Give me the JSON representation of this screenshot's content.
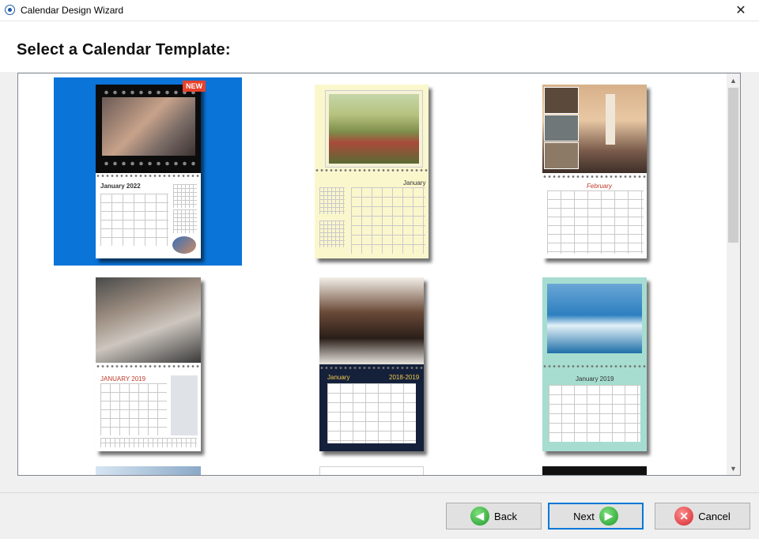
{
  "window": {
    "title": "Calendar Design Wizard",
    "close_glyph": "✕"
  },
  "page": {
    "heading": "Select a Calendar Template:"
  },
  "templates": [
    {
      "badge": "NEW",
      "caption": "January 2022"
    },
    {
      "caption": "January"
    },
    {
      "caption": "February"
    },
    {
      "caption": "JANUARY 2019"
    },
    {
      "caption": "January",
      "caption2": "2018-2019"
    },
    {
      "caption": "January 2019"
    }
  ],
  "buttons": {
    "back": "Back",
    "next": "Next",
    "cancel": "Cancel"
  },
  "icons": {
    "back": "◀",
    "next": "▶",
    "cancel": "✕"
  },
  "scroll": {
    "up": "▲",
    "down": "▼"
  },
  "colors": {
    "selection": "#0a74d9",
    "accent": "#0078d7",
    "badge": "#e8412c"
  }
}
